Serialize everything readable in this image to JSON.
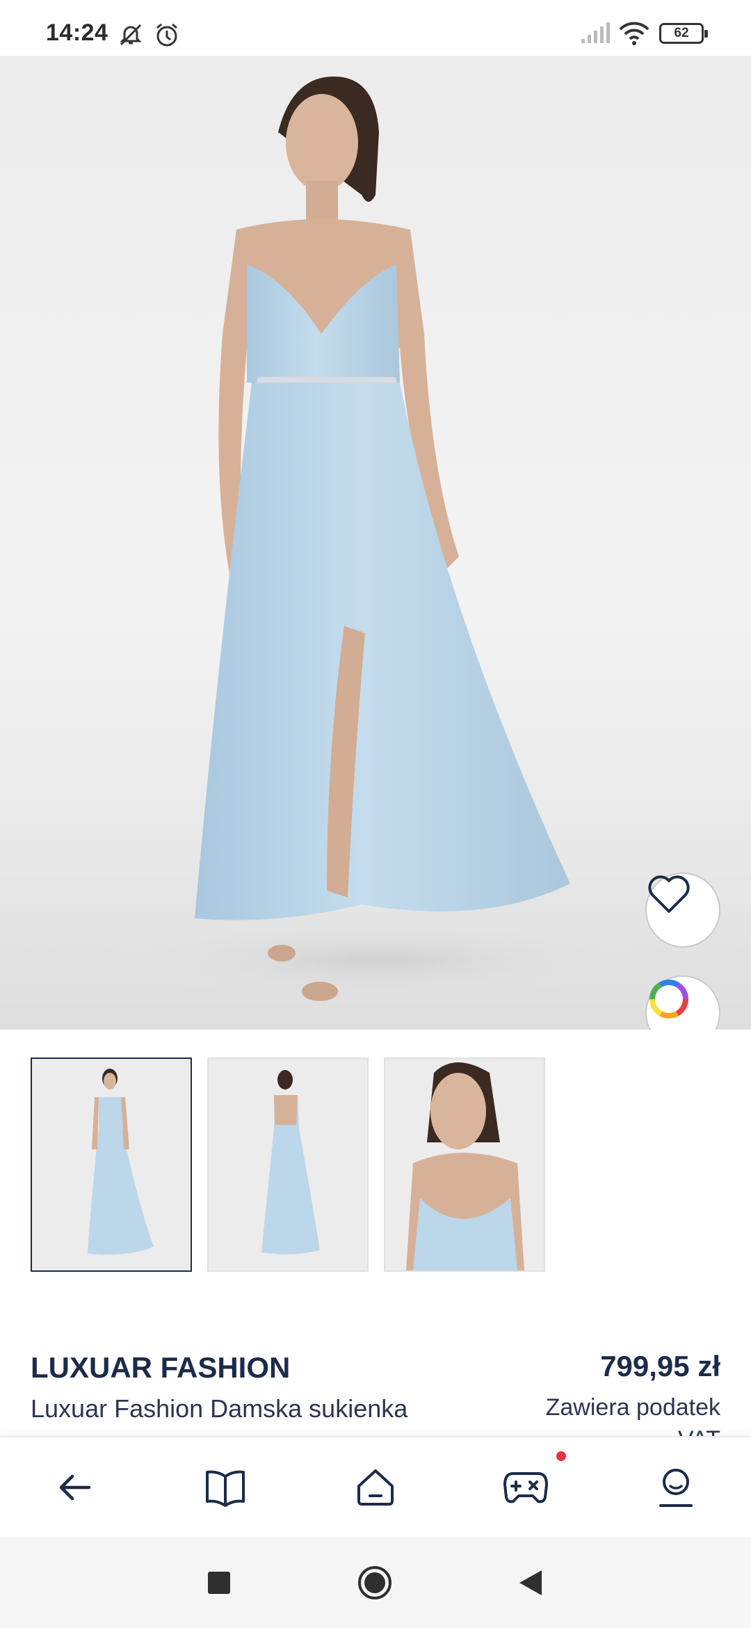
{
  "status_bar": {
    "time": "14:24",
    "icons": [
      "mute-icon",
      "alarm-icon",
      "signal-icon",
      "wifi-icon"
    ],
    "battery": "62"
  },
  "hero": {
    "image": "product-photo-light-blue-maxi-dress",
    "favorite_icon": "heart-icon",
    "color_icon": "color-wheel-icon"
  },
  "thumbnails": [
    {
      "view": "front",
      "active": true
    },
    {
      "view": "back",
      "active": false
    },
    {
      "view": "detail",
      "active": false
    }
  ],
  "product": {
    "brand": "LUXUAR FASHION",
    "name": "Luxuar Fashion Damska sukienka",
    "price": "799,95 zł",
    "tax_note": "Zawiera podatek VAT"
  },
  "bottom_nav": {
    "items": [
      "back-arrow-icon",
      "catalog-book-icon",
      "home-icon",
      "games-icon",
      "profile-icon"
    ],
    "badge_on": "games-icon"
  },
  "system_nav": {
    "buttons": [
      "recents-square-icon",
      "home-circle-icon",
      "back-triangle-icon"
    ]
  },
  "colors": {
    "brand_navy": "#1c2b4a",
    "dress_blue": "#bcd6ea",
    "badge_red": "#e5343f"
  }
}
